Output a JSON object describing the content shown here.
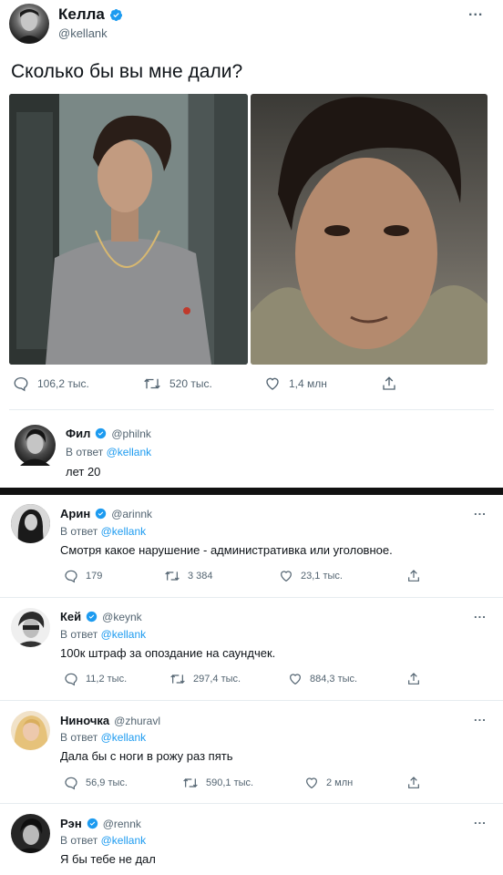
{
  "tweet": {
    "author_name": "Келла",
    "author_handle": "@kellank",
    "text": "Сколько бы вы мне дали?",
    "stats": {
      "replies": "106,2 тыс.",
      "retweets": "520 тыс.",
      "likes": "1,4 млн"
    }
  },
  "featured_reply": {
    "name": "Фил",
    "handle": "@philnk",
    "in_reply_prefix": "В ответ",
    "in_reply_to": "@kellank",
    "text": "лет 20"
  },
  "replies": [
    {
      "name": "Арин",
      "handle": "@arinnk",
      "in_reply_prefix": "В ответ",
      "in_reply_to": "@kellank",
      "text": "Смотря какое нарушение - административка или уголовное.",
      "replies": "179",
      "retweets": "3 384",
      "likes": "23,1 тыс."
    },
    {
      "name": "Кей",
      "handle": "@keynk",
      "in_reply_prefix": "В ответ",
      "in_reply_to": "@kellank",
      "text": "100к штраф за опоздание на саундчек.",
      "replies": "11,2 тыс.",
      "retweets": "297,4 тыс.",
      "likes": "884,3 тыс."
    },
    {
      "name": "Ниночка",
      "handle": "@zhuravl",
      "in_reply_prefix": "В ответ",
      "in_reply_to": "@kellank",
      "text": "Дала бы с ноги в рожу раз пять",
      "replies": "56,9 тыс.",
      "retweets": "590,1 тыс.",
      "likes": "2 млн"
    },
    {
      "name": "Рэн",
      "handle": "@rennk",
      "in_reply_prefix": "В ответ",
      "in_reply_to": "@kellank",
      "text": "Я бы тебе не дал"
    }
  ],
  "more_label": "...",
  "colors": {
    "verified": "#1d9bf0",
    "mention": "#1d9bf0",
    "muted": "#536471"
  }
}
